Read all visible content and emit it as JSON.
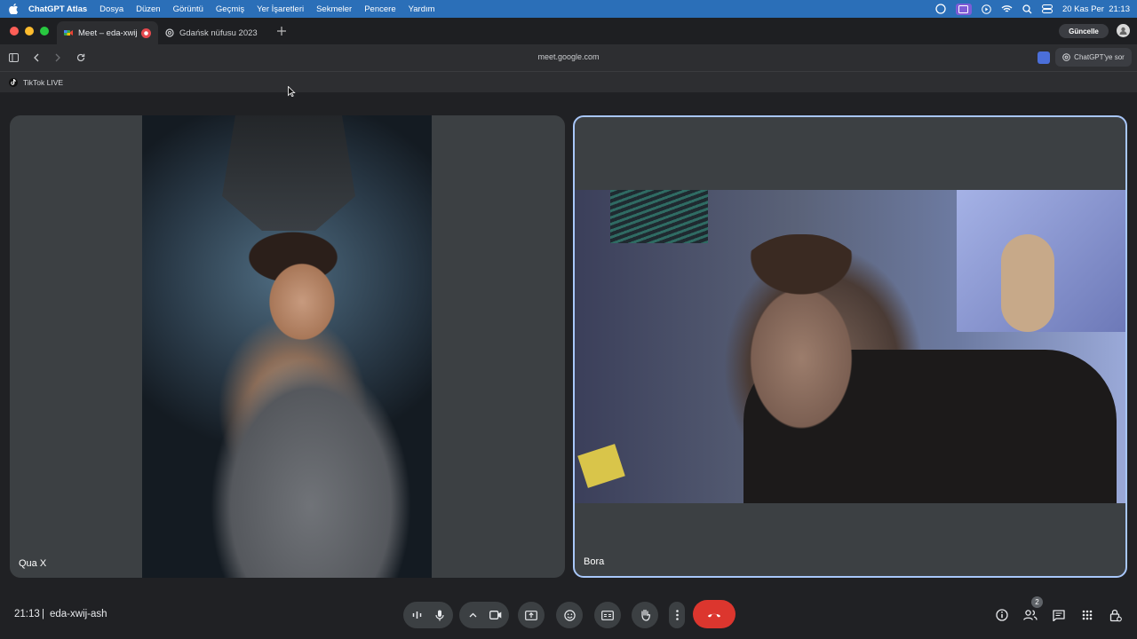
{
  "menubar": {
    "app": "ChatGPT Atlas",
    "items": [
      "Dosya",
      "Düzen",
      "Görüntü",
      "Geçmiş",
      "Yer İşaretleri",
      "Sekmeler",
      "Pencere",
      "Yardım"
    ],
    "datetime": "20 Kas Per  21:13"
  },
  "tabs": [
    {
      "label": "Meet – eda-xwij-a"
    },
    {
      "label": "Gdańsk nüfusu 2023"
    }
  ],
  "update_label": "Güncelle",
  "toolbar": {
    "url": "meet.google.com",
    "ask_label": "ChatGPT'ye sor"
  },
  "bookmarks": [
    {
      "label": "TikTok LIVE"
    }
  ],
  "participants": [
    {
      "name": "Qua X"
    },
    {
      "name": "Bora"
    }
  ],
  "meeting": {
    "time": "21:13",
    "separator": "|",
    "code": "eda-xwij-ash"
  },
  "participant_count": "2",
  "colors": {
    "menubar": "#2b6fb8",
    "end_call": "#dc362e",
    "active_speaker_border": "#a8c7fa",
    "tile_bg": "#3c4043",
    "page_bg": "#202124"
  },
  "icons": [
    "apple-icon",
    "meet-icon",
    "record-icon",
    "chatgpt-icon",
    "sidebar-icon",
    "back-icon",
    "forward-icon",
    "reload-icon",
    "tiktok-icon",
    "audio-levels-icon",
    "mic-icon",
    "chevron-up-icon",
    "camera-icon",
    "present-icon",
    "emoji-icon",
    "captions-icon",
    "raise-hand-icon",
    "more-options-icon",
    "hangup-icon",
    "info-icon",
    "people-icon",
    "chat-icon",
    "activities-icon",
    "host-controls-icon"
  ]
}
